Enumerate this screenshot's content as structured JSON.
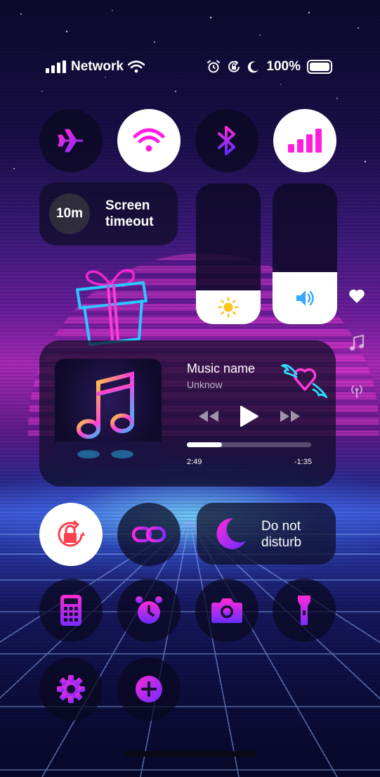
{
  "status_bar": {
    "carrier": "Network",
    "battery_percent": "100%",
    "icons": [
      "signal-bars-icon",
      "wifi-icon",
      "alarm-icon",
      "rotation-lock-icon",
      "moon-icon",
      "battery-icon"
    ]
  },
  "toggles": [
    {
      "name": "airplane-mode",
      "icon": "airplane-icon",
      "active": false
    },
    {
      "name": "wifi",
      "icon": "wifi-icon",
      "active": true
    },
    {
      "name": "bluetooth",
      "icon": "bluetooth-icon",
      "active": false
    },
    {
      "name": "mobile-data",
      "icon": "signal-bars-icon",
      "active": true
    }
  ],
  "screen_timeout": {
    "value": "10m",
    "label": "Screen timeout"
  },
  "brightness": {
    "level": 0.24,
    "icon": "sun-icon"
  },
  "volume": {
    "level": 0.37,
    "icon": "speaker-icon"
  },
  "side_icons": [
    "heart-icon",
    "music-note-icon",
    "broadcast-icon"
  ],
  "media": {
    "title": "Music name",
    "artist": "Unknow",
    "elapsed": "2:49",
    "remaining": "-1:35",
    "progress": 0.28
  },
  "do_not_disturb": {
    "label": "Do not disturb"
  },
  "shortcuts": [
    "rotation-lock-icon",
    "link-icon",
    "calculator-icon",
    "alarm-clock-icon",
    "camera-icon",
    "flashlight-icon",
    "settings-icon",
    "add-icon"
  ],
  "colors": {
    "accent_magenta": "#ff1ee0",
    "accent_purple": "#7b2cff",
    "brightness_sun": "#ffc21a",
    "volume_speaker": "#34a8ff",
    "rotation_lock_red": "#ff3e4e"
  }
}
